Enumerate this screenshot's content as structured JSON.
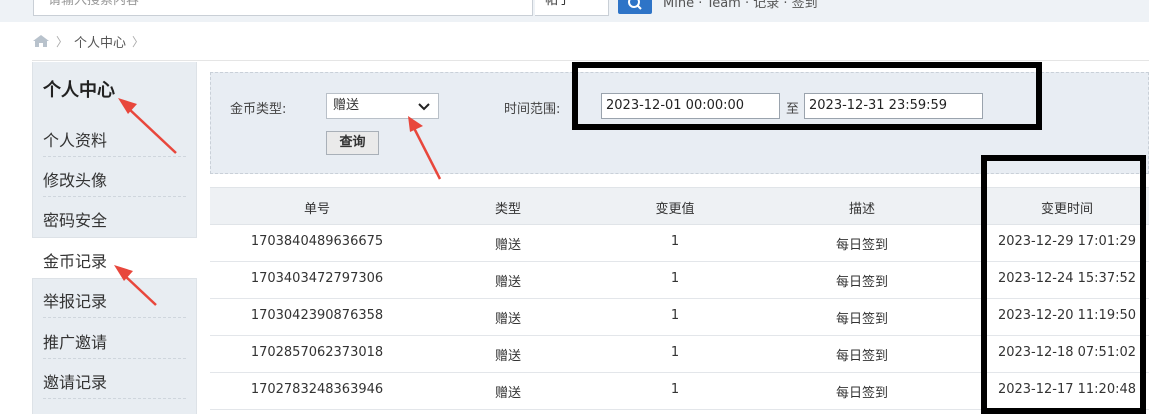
{
  "top": {
    "search_placeholder": "请输入搜索内容",
    "search_type": "帖子",
    "links": "Mine · Team · 记录 · 签到"
  },
  "breadcrumb": {
    "home_icon": "home-icon",
    "items": [
      "个人中心"
    ]
  },
  "sidebar": {
    "title": "个人中心",
    "items": [
      {
        "label": "个人资料"
      },
      {
        "label": "修改头像"
      },
      {
        "label": "密码安全"
      },
      {
        "label": "金币记录"
      },
      {
        "label": "举报记录"
      },
      {
        "label": "推广邀请"
      },
      {
        "label": "邀请记录"
      }
    ],
    "active_index": 3
  },
  "filter": {
    "coin_type_label": "金币类型:",
    "coin_type_value": "赠送",
    "time_range_label": "时间范围:",
    "start_time": "2023-12-01 00:00:00",
    "to_label": "至",
    "end_time": "2023-12-31 23:59:59",
    "query_button": "查询"
  },
  "table": {
    "headers": [
      "单号",
      "类型",
      "变更值",
      "描述",
      "变更时间"
    ],
    "rows": [
      [
        "1703840489636675",
        "赠送",
        "1",
        "每日签到",
        "2023-12-29 17:01:29"
      ],
      [
        "1703403472797306",
        "赠送",
        "1",
        "每日签到",
        "2023-12-24 15:37:52"
      ],
      [
        "1703042390876358",
        "赠送",
        "1",
        "每日签到",
        "2023-12-20 11:19:50"
      ],
      [
        "1702857062373018",
        "赠送",
        "1",
        "每日签到",
        "2023-12-18 07:51:02"
      ],
      [
        "1702783248363946",
        "赠送",
        "1",
        "每日签到",
        "2023-12-17 11:20:48"
      ]
    ]
  },
  "colors": {
    "accent": "#2e74c7",
    "annotation_arrow": "#e8473c",
    "highlight_box": "#000000"
  }
}
